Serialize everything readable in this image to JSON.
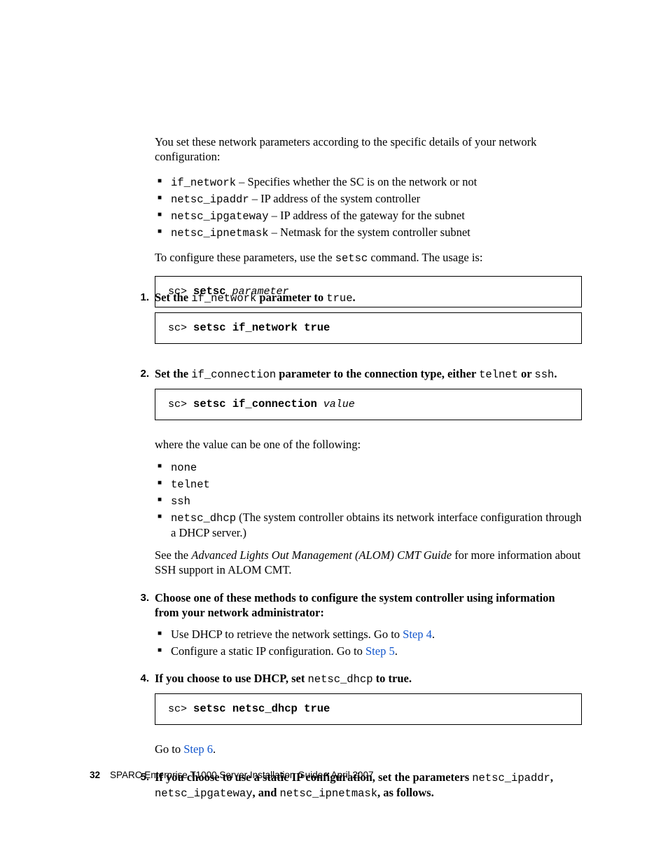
{
  "intro": {
    "p1": "You set these network parameters according to the specific details of your network configuration:",
    "bullets": [
      {
        "code": "if_network",
        "rest": " – Specifies whether the SC is on the network or not"
      },
      {
        "code": "netsc_ipaddr",
        "rest": " – IP address of the system controller"
      },
      {
        "code": "netsc_ipgateway",
        "rest": " – IP address of the gateway for the subnet"
      },
      {
        "code": "netsc_ipnetmask",
        "rest": " – Netmask for the system controller subnet"
      }
    ],
    "p2a": "To configure these parameters, use the ",
    "p2b": "setsc",
    "p2c": " command. The usage is:",
    "code1_prompt": "sc> ",
    "code1_bold": "setsc",
    "code1_ital": " parameter"
  },
  "step1": {
    "num": "1.",
    "t1": "Set the ",
    "c1": "if_network",
    "t2": " parameter to ",
    "c2": "true",
    "t3": ".",
    "code_prompt": "sc> ",
    "code_bold": "setsc if_network true"
  },
  "step2": {
    "num": "2.",
    "t1": "Set the ",
    "c1": "if_connection",
    "t2": " parameter to the connection type, either ",
    "c2": "telnet",
    "t3": " or ",
    "c3": "ssh",
    "t4": ".",
    "code_prompt": "sc> ",
    "code_bold": "setsc if_connection",
    "code_ital": " value",
    "p_after": "where the value can be one of the following:",
    "bullets": [
      {
        "code": "none",
        "rest": ""
      },
      {
        "code": "telnet",
        "rest": ""
      },
      {
        "code": "ssh",
        "rest": ""
      },
      {
        "code": "netsc_dhcp",
        "rest": " (The system controller obtains its network interface configuration through a DHCP server.)"
      }
    ],
    "see_a": "See the ",
    "see_i": "Advanced Lights Out Management (ALOM) CMT Guide",
    "see_b": " for more information about SSH support in ALOM CMT."
  },
  "step3": {
    "num": "3.",
    "text": "Choose one of these methods to configure the system controller using information from your network administrator:",
    "b1a": "Use DHCP to retrieve the network settings. Go to ",
    "b1link": "Step 4",
    "b1b": ".",
    "b2a": "Configure a static IP configuration. Go to ",
    "b2link": "Step 5",
    "b2b": "."
  },
  "step4": {
    "num": "4.",
    "t1": "If you choose to use DHCP, set ",
    "c1": "netsc_dhcp",
    "t2": " to true.",
    "code_prompt": "sc> ",
    "code_bold": "setsc netsc_dhcp true",
    "goto_a": "Go to ",
    "goto_link": "Step 6",
    "goto_b": "."
  },
  "step5": {
    "num": "5.",
    "t1": "If you choose to use a static IP configuration, set the parameters ",
    "c1": "netsc_ipaddr",
    "t2": ", ",
    "c2": "netsc_ipgateway",
    "t3": ", and ",
    "c3": "netsc_ipnetmask",
    "t4": ", as follows."
  },
  "footer": {
    "pageno": "32",
    "text": "SPARC Enterprise T1000 Server Installation Guide • April 2007"
  }
}
